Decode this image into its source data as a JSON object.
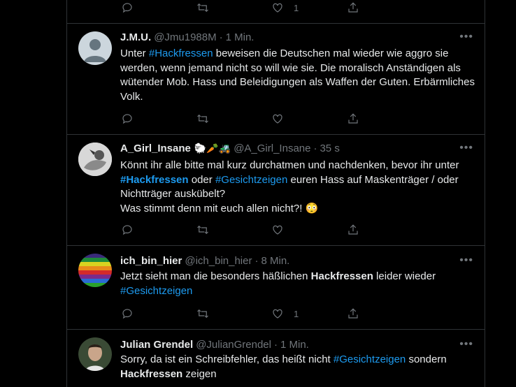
{
  "top_actions": {
    "like_count": "1"
  },
  "tweets": [
    {
      "name": "J.M.U.",
      "handle": "@Jmu1988M",
      "time": "1 Min.",
      "text": [
        {
          "t": "Unter "
        },
        {
          "t": "#Hackfressen",
          "c": "tag"
        },
        {
          "t": " beweisen die Deutschen mal wieder wie aggro sie werden, wenn jemand nicht so will wie sie. Die moralisch Anständigen als wütender Mob. Hass und Beleidigungen als Waffen der Guten. Erbärmliches Volk."
        }
      ],
      "like_count": ""
    },
    {
      "name": "A_Girl_Insane",
      "name_emoji": "🐑🥕🚜",
      "handle": "@A_Girl_Insane",
      "time": "35 s",
      "text": [
        {
          "t": "Könnt ihr alle bitte mal kurz durchatmen und nachdenken, bevor ihr unter "
        },
        {
          "t": "#Hackfressen",
          "c": "tag bold"
        },
        {
          "t": " oder "
        },
        {
          "t": "#Gesichtzeigen",
          "c": "tag"
        },
        {
          "t": " euren Hass auf Maskenträger / oder Nichtträger auskübelt?\nWas stimmt denn mit euch allen nicht?! 😳"
        }
      ],
      "like_count": ""
    },
    {
      "name": "ich_bin_hier",
      "handle": "@ich_bin_hier",
      "time": "8 Min.",
      "text": [
        {
          "t": "Jetzt sieht man die besonders häßlichen "
        },
        {
          "t": "Hackfressen",
          "c": "bold"
        },
        {
          "t": " leider wieder "
        },
        {
          "t": "#Gesichtzeigen",
          "c": "tag"
        }
      ],
      "like_count": "1"
    },
    {
      "name": "Julian Grendel",
      "handle": "@JulianGrendel",
      "time": "1 Min.",
      "text": [
        {
          "t": "Sorry, da ist ein Schreibfehler, das heißt nicht "
        },
        {
          "t": "#Gesichtzeigen",
          "c": "tag"
        },
        {
          "t": " sondern "
        },
        {
          "t": "Hackfressen",
          "c": "bold"
        },
        {
          "t": " zeigen"
        }
      ],
      "like_count": ""
    }
  ],
  "icons": [
    "reply-icon",
    "retweet-icon",
    "like-icon",
    "share-icon",
    "more-icon"
  ],
  "colors": {
    "background": "#000000",
    "link": "#1d9bf0",
    "muted": "#71767b",
    "divider": "#2f3336"
  }
}
